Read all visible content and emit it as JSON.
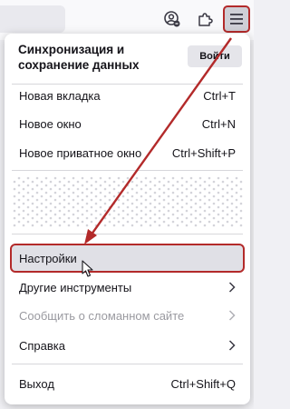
{
  "menu": {
    "sync_title": "Синхронизация и сохранение данных",
    "signin_label": "Войти",
    "items": [
      {
        "label": "Новая вкладка",
        "shortcut": "Ctrl+T"
      },
      {
        "label": "Новое окно",
        "shortcut": "Ctrl+N"
      },
      {
        "label": "Новое приватное окно",
        "shortcut": "Ctrl+Shift+P"
      },
      {
        "label": "Настройки"
      },
      {
        "label": "Другие инструменты"
      },
      {
        "label": "Сообщить о сломанном сайте"
      },
      {
        "label": "Справка"
      },
      {
        "label": "Выход",
        "shortcut": "Ctrl+Shift+Q"
      }
    ]
  },
  "colors": {
    "annotation": "#b32a2a",
    "panel_bg": "#ffffff",
    "toolbar_bg": "#f9f9fb",
    "highlight_bg": "#e0e0e6",
    "disabled_text": "#9a9aa0"
  },
  "icons": [
    "account-icon",
    "extensions-icon",
    "hamburger-menu-icon",
    "chevron-right-icon",
    "mouse-cursor-icon",
    "annotation-arrow"
  ]
}
